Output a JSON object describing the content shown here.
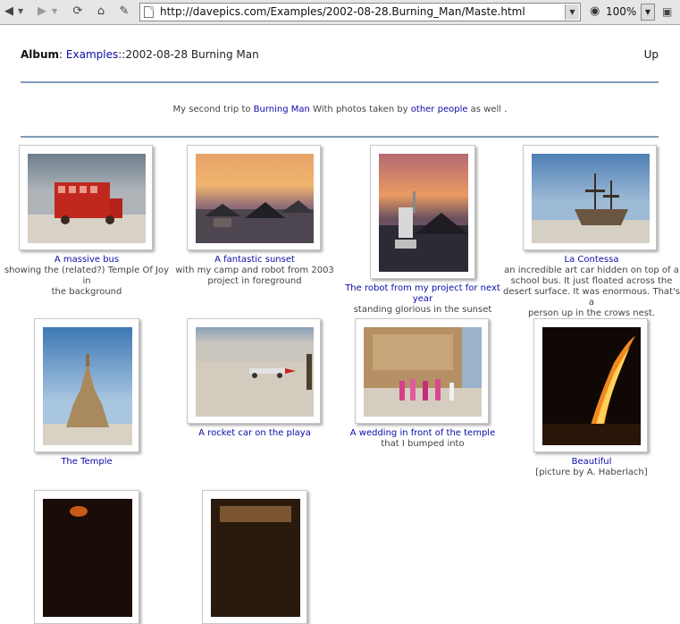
{
  "browser": {
    "url": "http://davepics.com/Examples/2002-08-28.Burning_Man/Maste.html",
    "zoom": "100%",
    "icons": [
      "back-icon",
      "forward-icon",
      "reload-icon",
      "home-icon",
      "bookmark-icon",
      "page-icon",
      "eye-icon",
      "camera-icon"
    ]
  },
  "header": {
    "album_label": "Album",
    "album_sep": ": ",
    "examples_link": "Examples",
    "path_sep": "::",
    "album_name": "2002-08-28 Burning Man",
    "up_link": "Up"
  },
  "description": {
    "part1": "My second trip to ",
    "link1": "Burning Man",
    "part2": " With photos taken by ",
    "link2": "other people",
    "part3": " as well ",
    "link3": "."
  },
  "colors": {
    "link": "#0b0ba8",
    "rule": "#7f9bba"
  },
  "photos": [
    {
      "title": "A massive bus",
      "line1": "showing the (related?) Temple Of Joy in",
      "line2": "the background",
      "line3": "",
      "line4": ""
    },
    {
      "title": "A fantastic sunset",
      "line1": "with my camp and robot from 2003",
      "line2": "project in foreground",
      "line3": "",
      "line4": ""
    },
    {
      "title": "The robot from my project for next year",
      "line1": "standing glorious in the sunset",
      "line2": "",
      "line3": "",
      "line4": ""
    },
    {
      "title": "La Contessa",
      "line1": "an incredible art car hidden on top of a",
      "line2": "school bus. It just floated across the",
      "line3": "desert surface. It was enormous. That's a",
      "line4": "person up in the crows nest."
    },
    {
      "title": "The Temple",
      "line1": "",
      "line2": "",
      "line3": "",
      "line4": ""
    },
    {
      "title": "A rocket car on the playa",
      "line1": "",
      "line2": "",
      "line3": "",
      "line4": ""
    },
    {
      "title": "A wedding in front of the temple",
      "line1": "that I bumped into",
      "line2": "",
      "line3": "",
      "line4": ""
    },
    {
      "title": "Beautiful",
      "line1": "[picture by A. Haberlach]",
      "line2": "",
      "line3": "",
      "line4": ""
    }
  ]
}
